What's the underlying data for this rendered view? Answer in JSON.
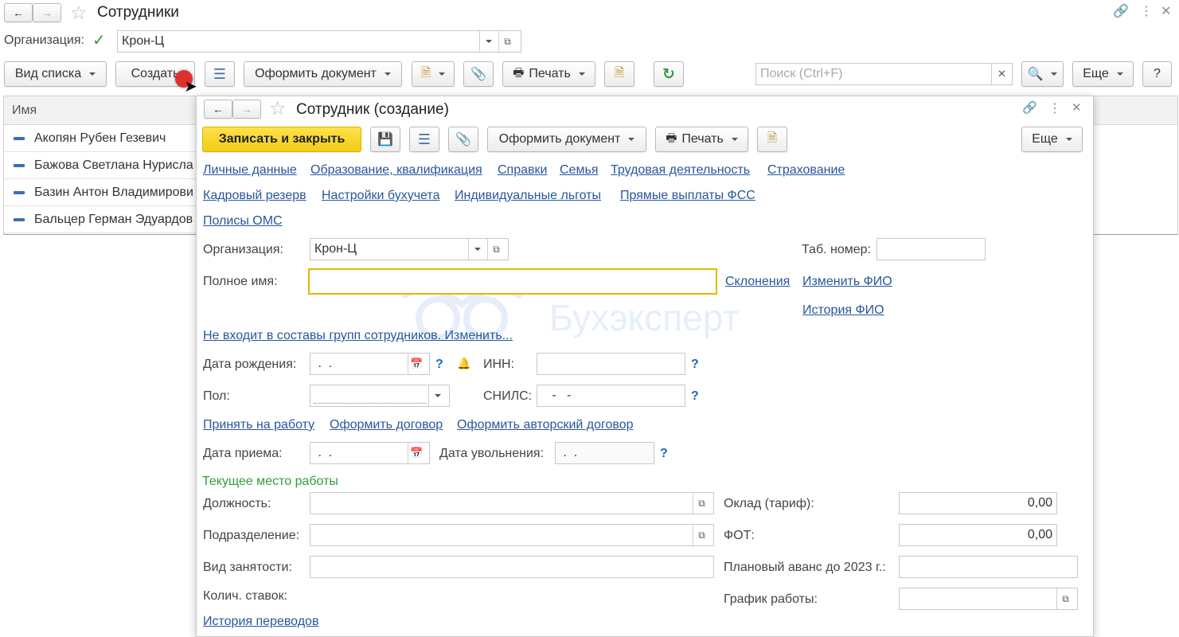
{
  "list_window": {
    "title": "Сотрудники",
    "org_label": "Организация:",
    "org_value": "Крон-Ц",
    "toolbar": {
      "view_list": "Вид списка",
      "create": "Создать",
      "make_document": "Оформить документ",
      "print": "Печать",
      "search_placeholder": "Поиск (Ctrl+F)",
      "more": "Еще",
      "help": "?"
    },
    "column_header": "Имя",
    "rows": [
      "Акопян Рубен Гезевич",
      "Бажова Светлана Нурисла",
      "Базин Антон Владимирови",
      "Бальцер Герман Эдуардов"
    ]
  },
  "form": {
    "title": "Сотрудник (создание)",
    "toolbar": {
      "save_close": "Записать и закрыть",
      "make_document": "Оформить документ",
      "print": "Печать",
      "more": "Еще"
    },
    "tabs_row1": [
      "Личные данные",
      "Образование, квалификация",
      "Справки",
      "Семья",
      "Трудовая деятельность",
      "Страхование"
    ],
    "tabs_row2": [
      "Кадровый резерв",
      "Настройки бухучета",
      "Индивидуальные льготы",
      "Прямые выплаты ФСС"
    ],
    "tabs_row3": [
      "Полисы ОМС"
    ],
    "org_label": "Организация:",
    "org_value": "Крон-Ц",
    "tab_num_label": "Таб. номер:",
    "tab_num_value": "",
    "full_name_label": "Полное имя:",
    "full_name_value": "",
    "declensions_link": "Склонения",
    "change_fio_link": "Изменить ФИО",
    "fio_history_link": "История ФИО",
    "groups_link": "Не входит в составы групп сотрудников. Изменить...",
    "birth_label": "Дата рождения:",
    "birth_value": " .  .",
    "inn_label": "ИНН:",
    "inn_value": "",
    "gender_label": "Пол:",
    "gender_value": "",
    "snils_label": "СНИЛС:",
    "snils_value": "   -   -",
    "hire_link": "Принять на работу",
    "contract_link": "Оформить договор",
    "author_contract_link": "Оформить авторский договор",
    "hire_date_label": "Дата приема:",
    "hire_date_value": " .  .",
    "dismiss_label": "Дата увольнения:",
    "dismiss_value": " .  .",
    "section_title": "Текущее место работы",
    "position_label": "Должность:",
    "department_label": "Подразделение:",
    "employment_label": "Вид занятости:",
    "rates_label": "Колич. ставок:",
    "salary_label": "Оклад (тариф):",
    "salary_value": "0,00",
    "fot_label": "ФОТ:",
    "fot_value": "0,00",
    "advance_label": "Плановый аванс до 2023 г.:",
    "schedule_label": "График работы:",
    "transfers_link": "История переводов",
    "question_mark": "?"
  },
  "watermark": "Бухэксперт",
  "colors": {
    "primary_button": "#f5d21f",
    "link": "#27579c",
    "section_title": "#2f9e3f",
    "focus_border": "#e5b800",
    "help_blue": "#1d6bb3"
  }
}
